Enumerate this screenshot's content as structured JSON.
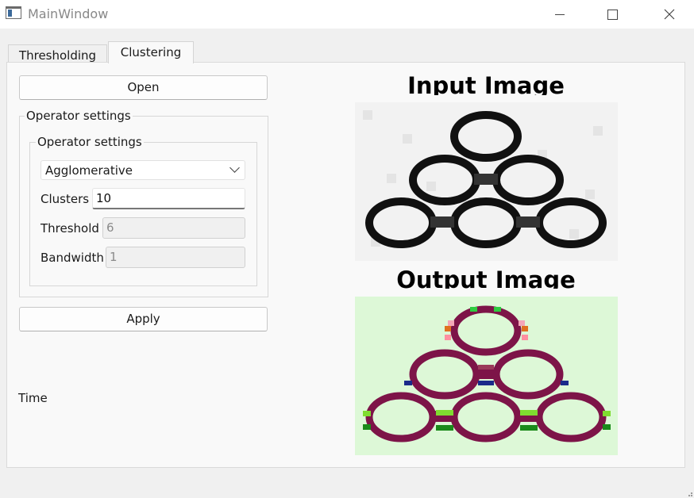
{
  "window": {
    "title": "MainWindow"
  },
  "tabs": [
    {
      "label": "Thresholding",
      "active": false
    },
    {
      "label": "Clustering",
      "active": true
    }
  ],
  "open_button": "Open",
  "outer_group_title": "Operator settings",
  "inner_group_title": "Operator settings",
  "algorithm": {
    "selected": "Agglomerative"
  },
  "fields": {
    "clusters": {
      "label": "Clusters",
      "value": "10",
      "enabled": true
    },
    "threshold": {
      "label": "Threshold",
      "value": "6",
      "enabled": false
    },
    "bandwidth": {
      "label": "Bandwidth",
      "value": "1",
      "enabled": false
    }
  },
  "apply_button": "Apply",
  "time_label": "Time",
  "input_heading": "Input Image",
  "output_heading": "Output Image",
  "colors": {
    "output_background": "#ddf8d7",
    "ring_color": "#7d1448",
    "input_background": "#f2f2f2"
  }
}
